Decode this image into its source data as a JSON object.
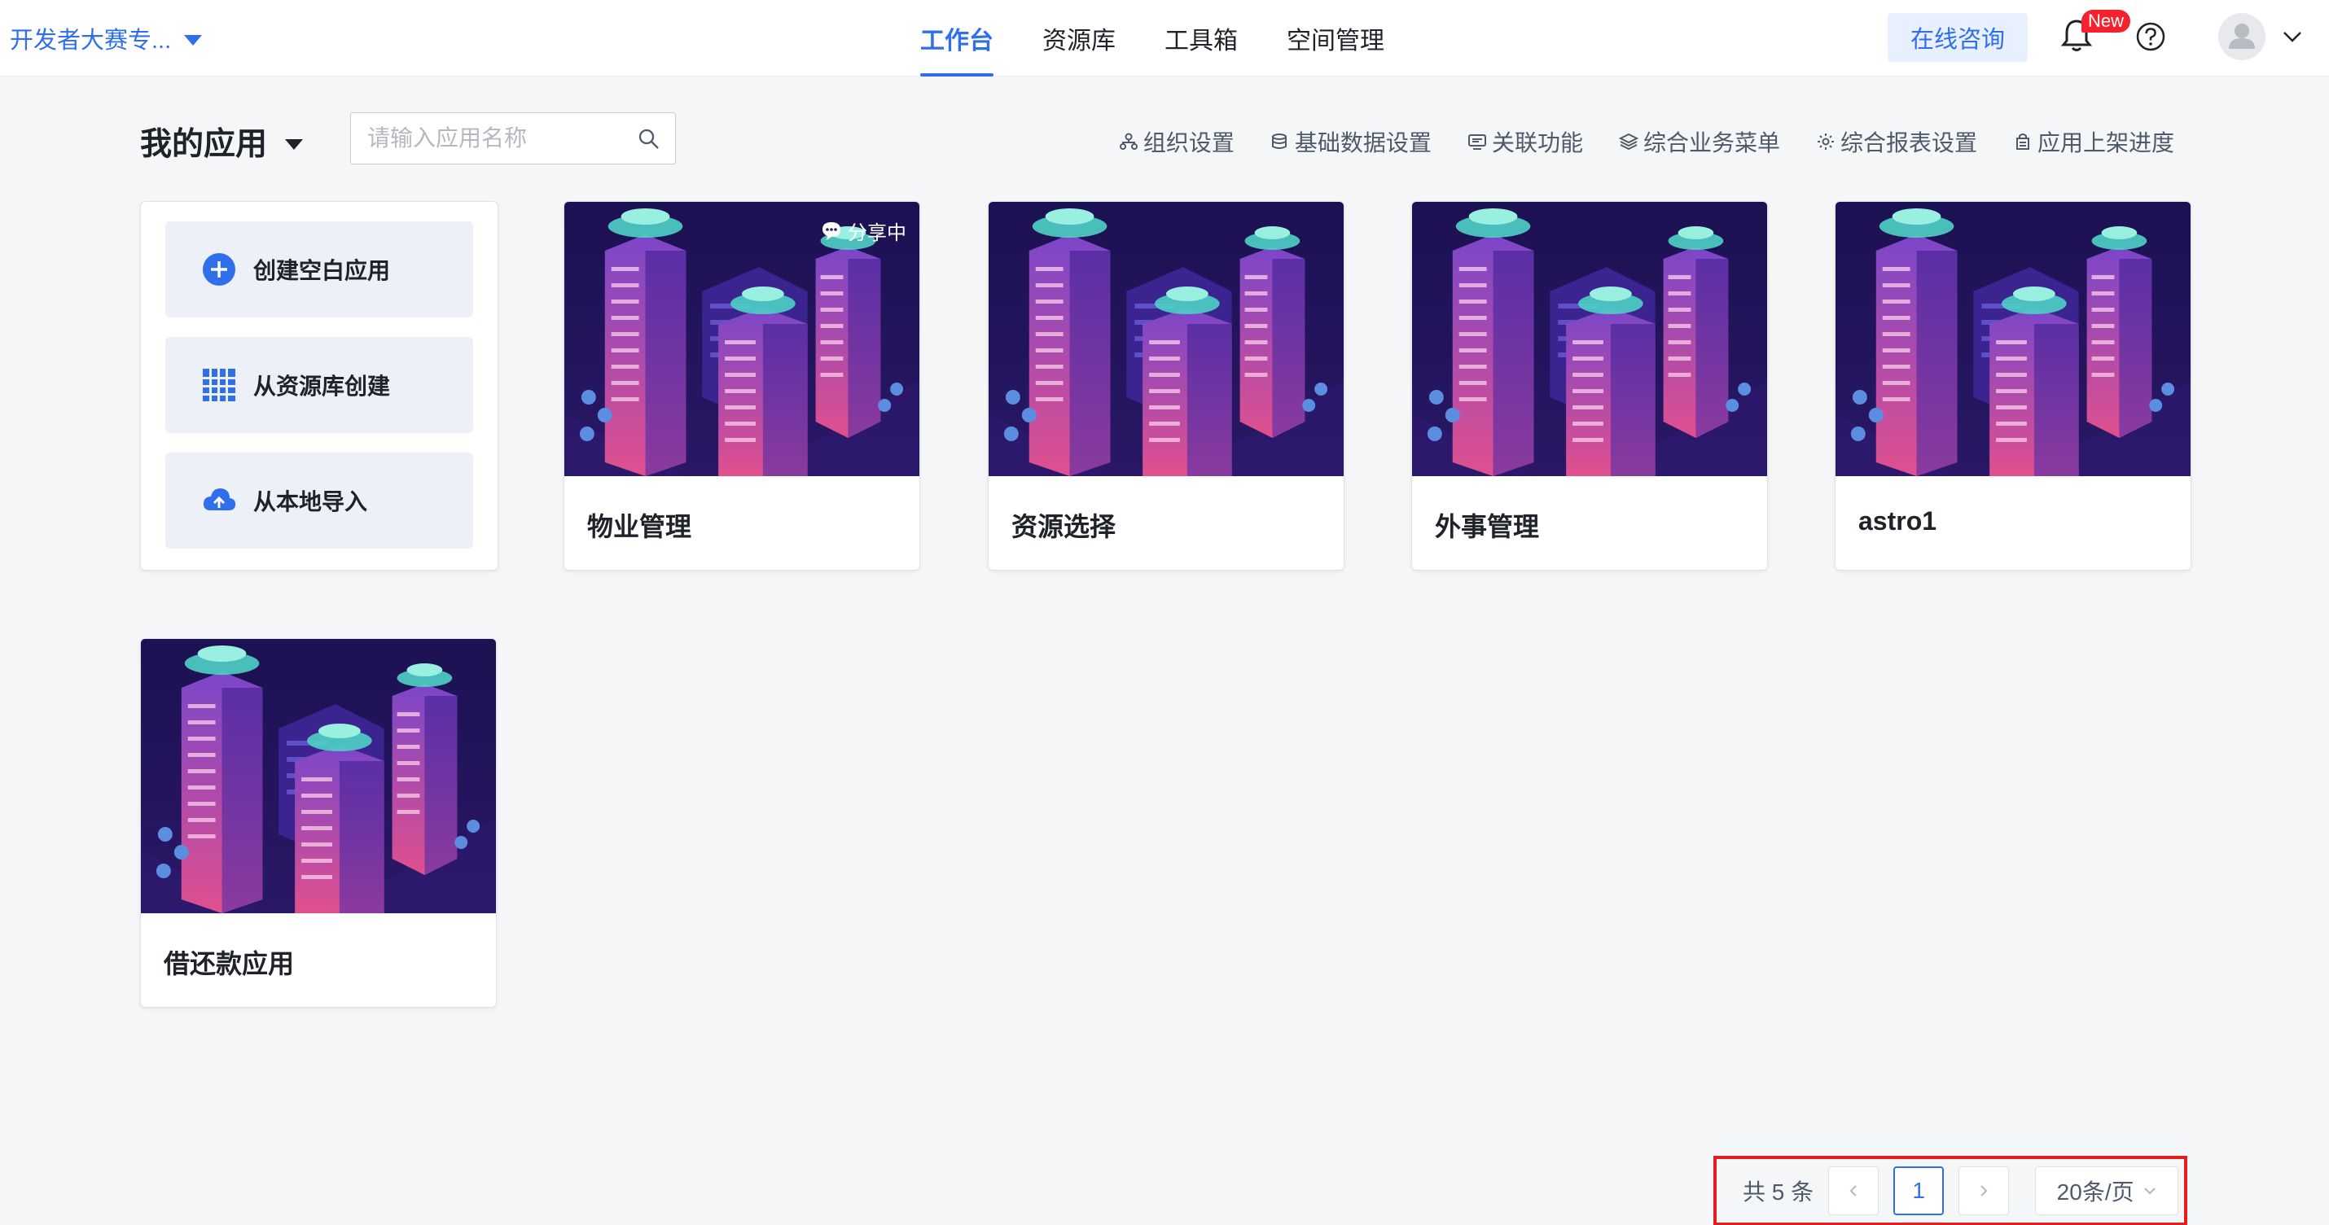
{
  "header": {
    "workspace": "开发者大赛专...",
    "tabs": [
      {
        "label": "工作台",
        "active": true
      },
      {
        "label": "资源库",
        "active": false
      },
      {
        "label": "工具箱",
        "active": false
      },
      {
        "label": "空间管理",
        "active": false
      }
    ],
    "consult_label": "在线咨询",
    "new_badge": "New",
    "accent_color": "#2f6fec"
  },
  "toolbar": {
    "title": "我的应用",
    "search_placeholder": "请输入应用名称",
    "settings": [
      {
        "label": "组织设置",
        "icon": "org-icon"
      },
      {
        "label": "基础数据设置",
        "icon": "database-icon"
      },
      {
        "label": "关联功能",
        "icon": "link-icon"
      },
      {
        "label": "综合业务菜单",
        "icon": "layers-icon"
      },
      {
        "label": "综合报表设置",
        "icon": "gear-icon"
      },
      {
        "label": "应用上架进度",
        "icon": "store-icon"
      }
    ]
  },
  "create_panel": {
    "blank": "创建空白应用",
    "from_library": "从资源库创建",
    "import_local": "从本地导入"
  },
  "apps": [
    {
      "name": "物业管理",
      "shared_label": "分享中"
    },
    {
      "name": "资源选择"
    },
    {
      "name": "外事管理"
    },
    {
      "name": "astro1"
    },
    {
      "name": "借还款应用"
    }
  ],
  "pagination": {
    "total_text": "共 5 条",
    "current_page": "1",
    "page_size": "20条/页"
  }
}
